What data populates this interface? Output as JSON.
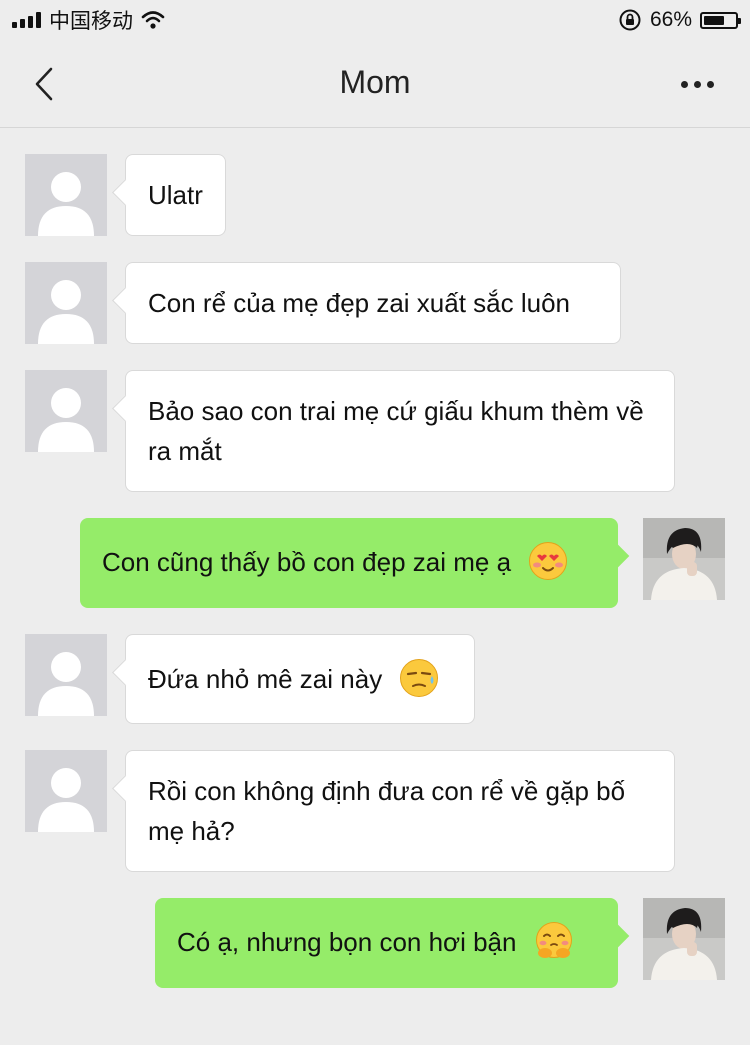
{
  "status_bar": {
    "carrier": "中国移动",
    "battery_percent_label": "66%",
    "battery_level": 0.66
  },
  "header": {
    "title": "Mom",
    "back_icon": "chevron-left-icon",
    "more_icon": "more-dots-icon"
  },
  "colors": {
    "background": "#ededed",
    "incoming_bubble": "#ffffff",
    "outgoing_bubble": "#95ec69"
  },
  "messages": [
    {
      "direction": "incoming",
      "text": "Ulatr"
    },
    {
      "direction": "incoming",
      "text": "Con rể của mẹ đẹp zai xuất sắc luôn"
    },
    {
      "direction": "incoming",
      "text": "Bảo sao con trai mẹ cứ giấu khum thèm về ra mắt"
    },
    {
      "direction": "outgoing",
      "text": "Con cũng thấy bồ con đẹp zai mẹ ạ",
      "emoji": "heart-eyes-blush-emoji"
    },
    {
      "direction": "incoming",
      "text": "Đứa nhỏ mê zai này",
      "emoji": "smirk-sweat-emoji"
    },
    {
      "direction": "incoming",
      "text": "Rồi con không định đưa con rể về gặp bố mẹ hả?"
    },
    {
      "direction": "outgoing",
      "text": "Có ạ, nhưng bọn con hơi bận",
      "emoji": "pleading-hands-emoji"
    }
  ]
}
